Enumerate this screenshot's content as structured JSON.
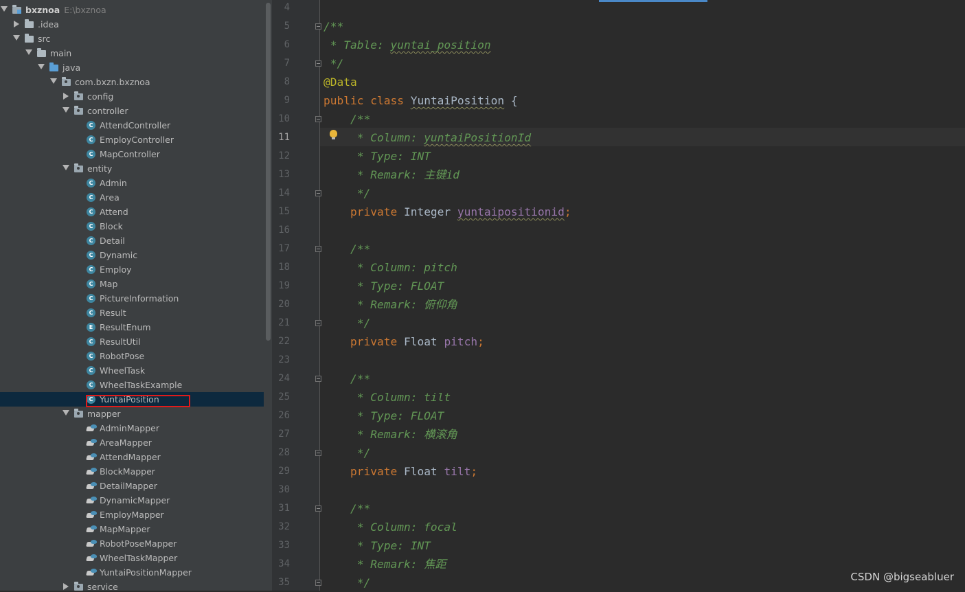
{
  "project": {
    "name": "bxznoa",
    "path": "E:\\bxznoa"
  },
  "tree": [
    {
      "label": "bxznoa",
      "hint": "E:\\bxznoa",
      "type": "project",
      "indent": 0,
      "expanded": true
    },
    {
      "label": ".idea",
      "type": "folder",
      "indent": 1,
      "expanded": false
    },
    {
      "label": "src",
      "type": "folder",
      "indent": 1,
      "expanded": true
    },
    {
      "label": "main",
      "type": "folder",
      "indent": 2,
      "expanded": true
    },
    {
      "label": "java",
      "type": "java-folder",
      "indent": 3,
      "expanded": true
    },
    {
      "label": "com.bxzn.bxznoa",
      "type": "package",
      "indent": 4,
      "expanded": true
    },
    {
      "label": "config",
      "type": "package",
      "indent": 5,
      "expanded": false
    },
    {
      "label": "controller",
      "type": "package",
      "indent": 5,
      "expanded": true
    },
    {
      "label": "AttendController",
      "type": "class",
      "indent": 6
    },
    {
      "label": "EmployController",
      "type": "class",
      "indent": 6
    },
    {
      "label": "MapController",
      "type": "class",
      "indent": 6
    },
    {
      "label": "entity",
      "type": "package",
      "indent": 5,
      "expanded": true
    },
    {
      "label": "Admin",
      "type": "class",
      "indent": 6
    },
    {
      "label": "Area",
      "type": "class",
      "indent": 6
    },
    {
      "label": "Attend",
      "type": "class",
      "indent": 6
    },
    {
      "label": "Block",
      "type": "class",
      "indent": 6
    },
    {
      "label": "Detail",
      "type": "class",
      "indent": 6
    },
    {
      "label": "Dynamic",
      "type": "class",
      "indent": 6
    },
    {
      "label": "Employ",
      "type": "class",
      "indent": 6
    },
    {
      "label": "Map",
      "type": "class",
      "indent": 6
    },
    {
      "label": "PictureInformation",
      "type": "class",
      "indent": 6
    },
    {
      "label": "Result",
      "type": "class",
      "indent": 6
    },
    {
      "label": "ResultEnum",
      "type": "enum",
      "indent": 6
    },
    {
      "label": "ResultUtil",
      "type": "class",
      "indent": 6
    },
    {
      "label": "RobotPose",
      "type": "class",
      "indent": 6
    },
    {
      "label": "WheelTask",
      "type": "class",
      "indent": 6
    },
    {
      "label": "WheelTaskExample",
      "type": "class",
      "indent": 6
    },
    {
      "label": "YuntaiPosition",
      "type": "class",
      "indent": 6,
      "selected": true
    },
    {
      "label": "mapper",
      "type": "package",
      "indent": 5,
      "expanded": true
    },
    {
      "label": "AdminMapper",
      "type": "mapper",
      "indent": 6
    },
    {
      "label": "AreaMapper",
      "type": "mapper",
      "indent": 6
    },
    {
      "label": "AttendMapper",
      "type": "mapper",
      "indent": 6
    },
    {
      "label": "BlockMapper",
      "type": "mapper",
      "indent": 6
    },
    {
      "label": "DetailMapper",
      "type": "mapper",
      "indent": 6
    },
    {
      "label": "DynamicMapper",
      "type": "mapper",
      "indent": 6
    },
    {
      "label": "EmployMapper",
      "type": "mapper",
      "indent": 6
    },
    {
      "label": "MapMapper",
      "type": "mapper",
      "indent": 6
    },
    {
      "label": "RobotPoseMapper",
      "type": "mapper",
      "indent": 6
    },
    {
      "label": "WheelTaskMapper",
      "type": "mapper",
      "indent": 6
    },
    {
      "label": "YuntaiPositionMapper",
      "type": "mapper",
      "indent": 6
    },
    {
      "label": "service",
      "type": "package",
      "indent": 5,
      "expanded": false
    }
  ],
  "icons": {
    "class_letter": "C",
    "enum_letter": "E"
  },
  "editor": {
    "current_line": 11,
    "lines": [
      {
        "n": 4,
        "segs": []
      },
      {
        "n": 5,
        "fold": true,
        "segs": [
          {
            "t": "/**",
            "c": "c-comment"
          }
        ]
      },
      {
        "n": 6,
        "segs": [
          {
            "t": " * Table: ",
            "c": "c-comment"
          },
          {
            "t": "yuntai_position",
            "c": "c-comment squiggle"
          }
        ]
      },
      {
        "n": 7,
        "fold": true,
        "segs": [
          {
            "t": " */",
            "c": "c-comment"
          }
        ]
      },
      {
        "n": 8,
        "segs": [
          {
            "t": "@Data",
            "c": "c-anno"
          }
        ]
      },
      {
        "n": 9,
        "segs": [
          {
            "t": "public class ",
            "c": "c-kw"
          },
          {
            "t": "YuntaiPosition",
            "c": "c-plain squiggle"
          },
          {
            "t": " {",
            "c": "c-plain"
          }
        ]
      },
      {
        "n": 10,
        "fold": true,
        "segs": [
          {
            "t": "    /**",
            "c": "c-comment"
          }
        ]
      },
      {
        "n": 11,
        "segs": [
          {
            "t": "     * Column: ",
            "c": "c-comment"
          },
          {
            "t": "yuntaiPositionId",
            "c": "c-comment squiggle"
          }
        ]
      },
      {
        "n": 12,
        "segs": [
          {
            "t": "     * Type: INT",
            "c": "c-comment"
          }
        ]
      },
      {
        "n": 13,
        "segs": [
          {
            "t": "     * Remark: 主键id",
            "c": "c-comment"
          }
        ]
      },
      {
        "n": 14,
        "fold": true,
        "segs": [
          {
            "t": "     */",
            "c": "c-comment"
          }
        ]
      },
      {
        "n": 15,
        "segs": [
          {
            "t": "    private ",
            "c": "c-kw"
          },
          {
            "t": "Integer ",
            "c": "c-plain"
          },
          {
            "t": "yuntaipositionid",
            "c": "c-field squiggle"
          },
          {
            "t": ";",
            "c": "c-kw"
          }
        ]
      },
      {
        "n": 16,
        "segs": []
      },
      {
        "n": 17,
        "fold": true,
        "segs": [
          {
            "t": "    /**",
            "c": "c-comment"
          }
        ]
      },
      {
        "n": 18,
        "segs": [
          {
            "t": "     * Column: pitch",
            "c": "c-comment"
          }
        ]
      },
      {
        "n": 19,
        "segs": [
          {
            "t": "     * Type: FLOAT",
            "c": "c-comment"
          }
        ]
      },
      {
        "n": 20,
        "segs": [
          {
            "t": "     * Remark: 俯仰角",
            "c": "c-comment"
          }
        ]
      },
      {
        "n": 21,
        "fold": true,
        "segs": [
          {
            "t": "     */",
            "c": "c-comment"
          }
        ]
      },
      {
        "n": 22,
        "segs": [
          {
            "t": "    private ",
            "c": "c-kw"
          },
          {
            "t": "Float ",
            "c": "c-plain"
          },
          {
            "t": "pitch",
            "c": "c-field"
          },
          {
            "t": ";",
            "c": "c-kw"
          }
        ]
      },
      {
        "n": 23,
        "segs": []
      },
      {
        "n": 24,
        "fold": true,
        "segs": [
          {
            "t": "    /**",
            "c": "c-comment"
          }
        ]
      },
      {
        "n": 25,
        "segs": [
          {
            "t": "     * Column: tilt",
            "c": "c-comment"
          }
        ]
      },
      {
        "n": 26,
        "segs": [
          {
            "t": "     * Type: FLOAT",
            "c": "c-comment"
          }
        ]
      },
      {
        "n": 27,
        "segs": [
          {
            "t": "     * Remark: 横滚角",
            "c": "c-comment"
          }
        ]
      },
      {
        "n": 28,
        "fold": true,
        "segs": [
          {
            "t": "     */",
            "c": "c-comment"
          }
        ]
      },
      {
        "n": 29,
        "segs": [
          {
            "t": "    private ",
            "c": "c-kw"
          },
          {
            "t": "Float ",
            "c": "c-plain"
          },
          {
            "t": "tilt",
            "c": "c-field"
          },
          {
            "t": ";",
            "c": "c-kw"
          }
        ]
      },
      {
        "n": 30,
        "segs": []
      },
      {
        "n": 31,
        "fold": true,
        "segs": [
          {
            "t": "    /**",
            "c": "c-comment"
          }
        ]
      },
      {
        "n": 32,
        "segs": [
          {
            "t": "     * Column: focal",
            "c": "c-comment"
          }
        ]
      },
      {
        "n": 33,
        "segs": [
          {
            "t": "     * Type: INT",
            "c": "c-comment"
          }
        ]
      },
      {
        "n": 34,
        "segs": [
          {
            "t": "     * Remark: 焦距",
            "c": "c-comment"
          }
        ]
      },
      {
        "n": 35,
        "fold": true,
        "segs": [
          {
            "t": "     */",
            "c": "c-comment"
          }
        ]
      }
    ]
  },
  "watermark": "CSDN @bigseabluer",
  "colors": {
    "tree_bg": "#3c3f41",
    "editor_bg": "#2b2b2b",
    "selection": "#0d293e",
    "highlight_box": "#e01b1b",
    "comment": "#629755",
    "keyword": "#cc7832",
    "field": "#9876aa",
    "annotation": "#bbb529"
  }
}
